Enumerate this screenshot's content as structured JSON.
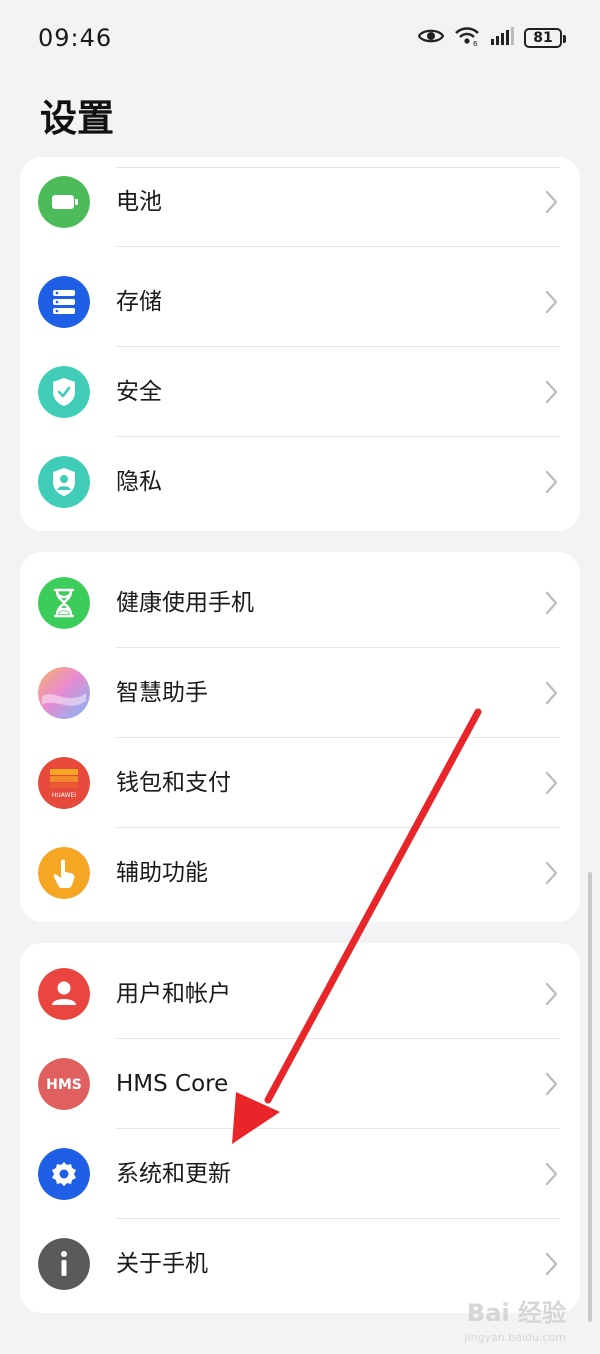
{
  "status_bar": {
    "time": "09:46",
    "battery": "81"
  },
  "page_title": "设置",
  "groups": [
    {
      "items": [
        {
          "label": "电池",
          "icon": "battery-icon",
          "color": "#4cbc5b"
        },
        {
          "label": "存储",
          "icon": "storage-icon",
          "color": "#1e5fe6"
        },
        {
          "label": "安全",
          "icon": "security-shield-icon",
          "color": "#3fcdb8"
        },
        {
          "label": "隐私",
          "icon": "privacy-shield-icon",
          "color": "#3fcdb8"
        }
      ]
    },
    {
      "items": [
        {
          "label": "健康使用手机",
          "icon": "hourglass-icon",
          "color": "#3ccc5a"
        },
        {
          "label": "智慧助手",
          "icon": "assistant-orb-icon",
          "color": "#c9a8f0"
        },
        {
          "label": "钱包和支付",
          "icon": "wallet-icon",
          "color": "#e74a3b"
        },
        {
          "label": "辅助功能",
          "icon": "accessibility-hand-icon",
          "color": "#f5a623"
        }
      ]
    },
    {
      "items": [
        {
          "label": "用户和帐户",
          "icon": "user-icon",
          "color": "#e8463e"
        },
        {
          "label": "HMS Core",
          "icon": "hms-icon",
          "color": "#e06060"
        },
        {
          "label": "系统和更新",
          "icon": "gear-icon",
          "color": "#1e5fe6"
        },
        {
          "label": "关于手机",
          "icon": "info-icon",
          "color": "#5a5a5a"
        }
      ]
    }
  ],
  "wallet_icon_text": "HUAWEI",
  "hms_icon_text": "HMS",
  "watermark": {
    "brand": "Bai 经验",
    "url": "jingyan.baidu.com"
  }
}
